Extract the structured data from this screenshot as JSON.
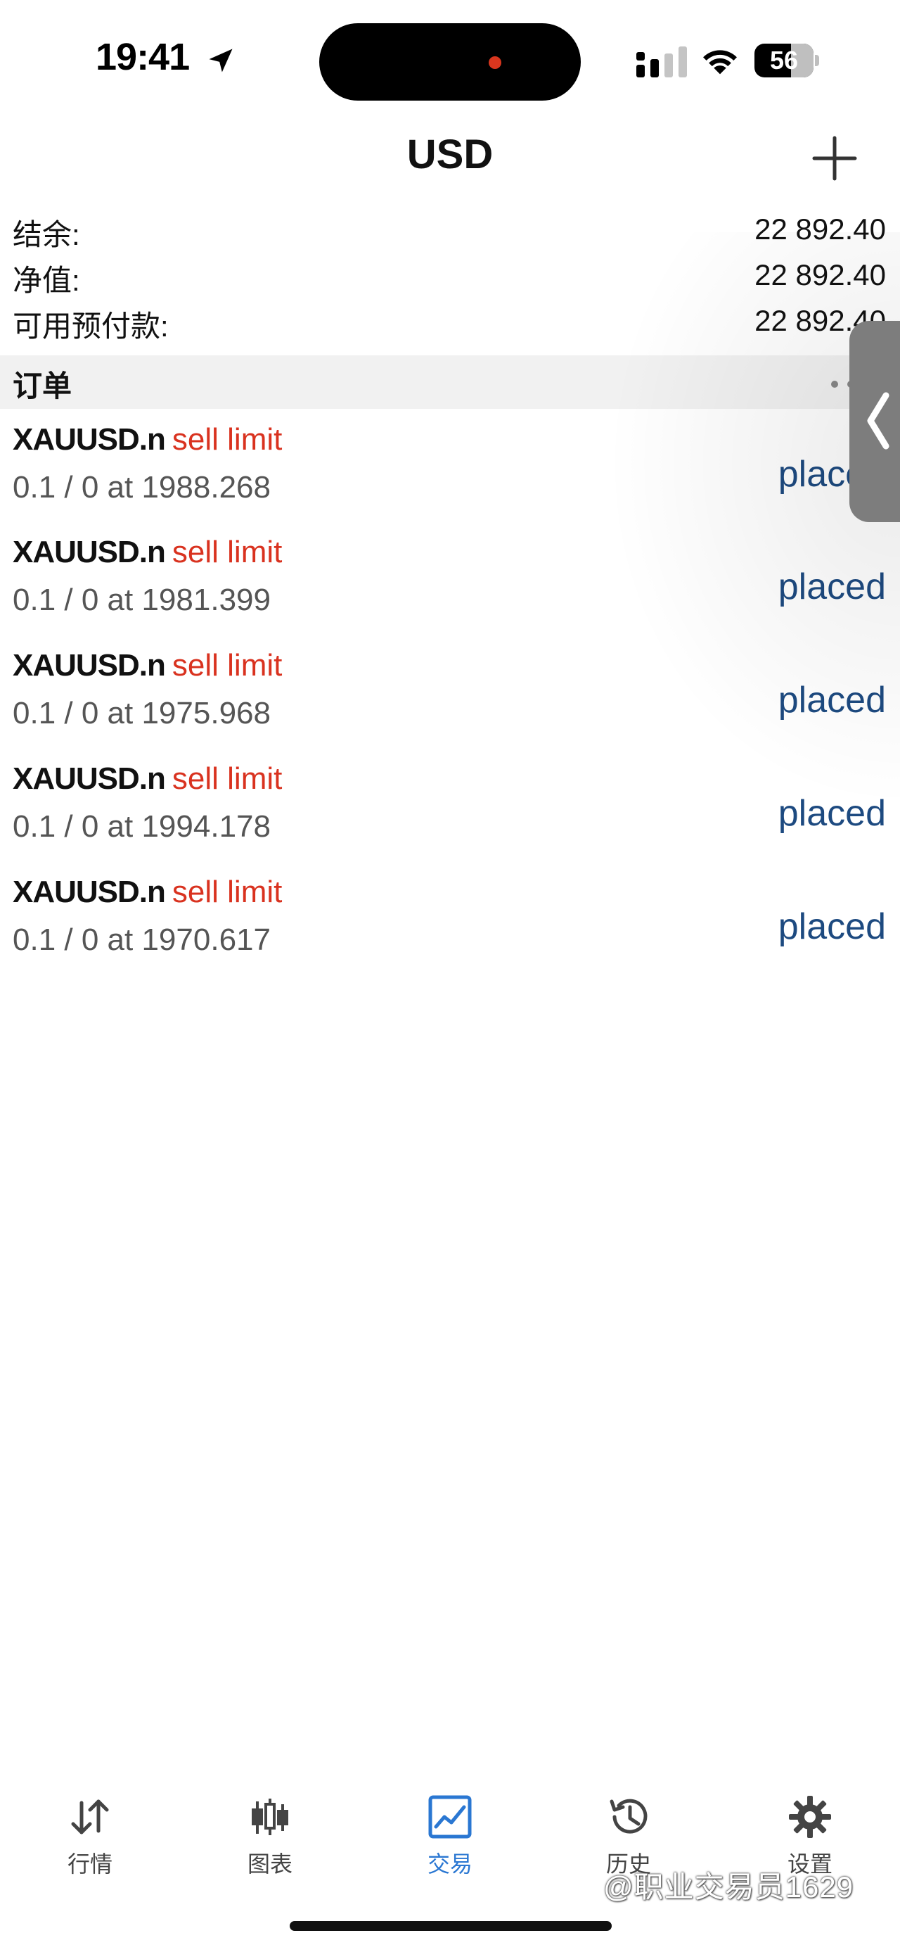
{
  "status_bar": {
    "time": "19:41",
    "battery_level": "56",
    "icons": [
      "location-arrow-icon",
      "cellular-signal-icon",
      "wifi-icon",
      "battery-icon"
    ]
  },
  "nav": {
    "title": "USD",
    "add_icon": "plus-icon"
  },
  "summary": {
    "rows": [
      {
        "label": "结余:",
        "value": "22 892.40"
      },
      {
        "label": "净值:",
        "value": "22 892.40"
      },
      {
        "label": "可用预付款:",
        "value": "22 892.40"
      }
    ]
  },
  "orders_section": {
    "title": "订单",
    "more_icon": "ellipsis-icon"
  },
  "orders": [
    {
      "symbol": "XAUUSD.n",
      "type": "sell limit",
      "detail": "0.1 / 0 at 1988.268",
      "status": "placed"
    },
    {
      "symbol": "XAUUSD.n",
      "type": "sell limit",
      "detail": "0.1 / 0 at 1981.399",
      "status": "placed"
    },
    {
      "symbol": "XAUUSD.n",
      "type": "sell limit",
      "detail": "0.1 / 0 at 1975.968",
      "status": "placed"
    },
    {
      "symbol": "XAUUSD.n",
      "type": "sell limit",
      "detail": "0.1 / 0 at 1994.178",
      "status": "placed"
    },
    {
      "symbol": "XAUUSD.n",
      "type": "sell limit",
      "detail": "0.1 / 0 at 1970.617",
      "status": "placed"
    }
  ],
  "side_handle": {
    "icon": "chevron-left-icon"
  },
  "tabs": [
    {
      "label": "行情",
      "icon": "quotes-arrows-icon",
      "active": false
    },
    {
      "label": "图表",
      "icon": "candlestick-chart-icon",
      "active": false
    },
    {
      "label": "交易",
      "icon": "trade-chart-icon",
      "active": true
    },
    {
      "label": "历史",
      "icon": "history-clock-icon",
      "active": false
    },
    {
      "label": "设置",
      "icon": "gear-icon",
      "active": false
    }
  ],
  "watermark": "@职业交易员1629",
  "colors": {
    "sell_text": "#d9321f",
    "status_text": "#1d4a80",
    "active_tab": "#2a77d2",
    "section_bg": "#f1f1f1"
  }
}
